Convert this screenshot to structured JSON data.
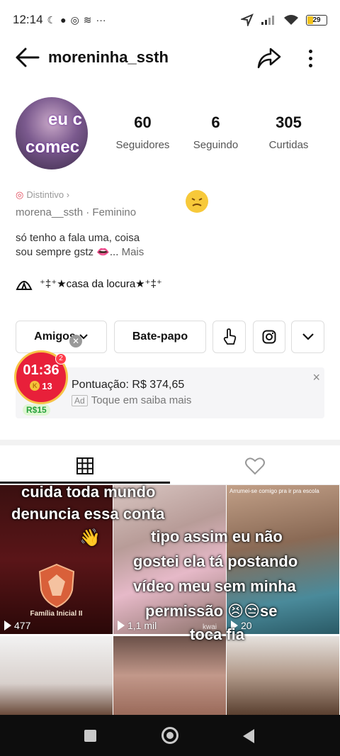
{
  "status_bar": {
    "time": "12:14",
    "battery": "29",
    "battery_level": 0.29,
    "more": "···"
  },
  "header": {
    "username": "moreninha_ssth"
  },
  "profile": {
    "avatar_overlay_line1": "eu c",
    "avatar_overlay_line2": "comec",
    "stats": [
      {
        "number": "60",
        "label": "Seguidores"
      },
      {
        "number": "6",
        "label": "Seguindo"
      },
      {
        "number": "305",
        "label": "Curtidas"
      }
    ],
    "pronoun": "Distintivo ›",
    "handle": "morena__ssth",
    "gender": "Feminino",
    "bio_line1": "só tenho a fala uma, coisa",
    "bio_line2": "sou sempre gstz 👄...",
    "bio_more": "Mais",
    "link_text": "⁺‡⁺★casa da locura★⁺‡⁺",
    "floating_emoji": "😣"
  },
  "actions": {
    "friends": "Amigos",
    "chat": "Bate-papo"
  },
  "ad": {
    "timer": "01:36",
    "coins": "13",
    "coin_symbol": "K",
    "badge": "2",
    "reward": "R$15",
    "title": "Pontuação: R$ 374,65",
    "tag": "Ad",
    "subtitle": "Toque em saiba mais",
    "close": "×"
  },
  "grid": {
    "videos": [
      {
        "views": "477",
        "caption": "Família Inicial II"
      },
      {
        "views": "1,1 mil",
        "watermark": "kwai"
      },
      {
        "views": "20",
        "caption": "Arrumei-se comigo pra ir pra escola"
      }
    ],
    "overlay_line1": "cuida toda mundo",
    "overlay_line2": "denuncia essa conta",
    "overlay_emoji": "👋",
    "overlay_line3": "tipo assim eu não",
    "overlay_line4": "gostei ela tá postando",
    "overlay_line5": "vídeo meu sem minha",
    "overlay_line6": "permissão 😣😒se",
    "overlay_line7": "toca fia"
  },
  "colors": {
    "accent": "#e8203a",
    "ad_bg": "#f5f5f7"
  }
}
